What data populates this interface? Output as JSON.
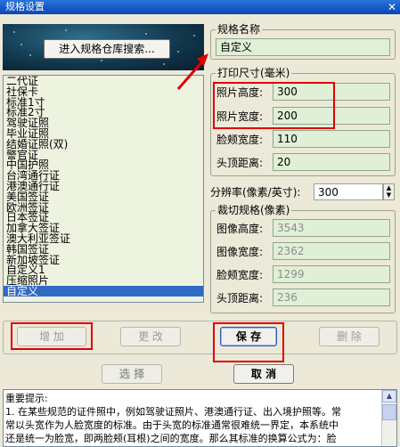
{
  "window": {
    "title": "规格设置",
    "close_glyph": "✕"
  },
  "search_button": "进入规格仓库搜索...",
  "spec_list": {
    "items": [
      "二代证",
      "社保卡",
      "标准1寸",
      "标准2寸",
      "驾驶证照",
      "毕业证照",
      "结婚证照(双)",
      "警官证",
      "中国护照",
      "台湾通行证",
      "港澳通行证",
      "美国签证",
      "欧洲签证",
      "日本签证",
      "加拿大签证",
      "澳大利亚签证",
      "韩国签证",
      "新加坡签证",
      "自定义1",
      "压缩照片",
      "自定义"
    ],
    "selected_index": 20
  },
  "spec_name": {
    "label": "规格名称",
    "value": "自定义"
  },
  "print_size": {
    "label": "打印尺寸(毫米)",
    "photo_height": {
      "label": "照片高度:",
      "value": "300"
    },
    "photo_width": {
      "label": "照片宽度:",
      "value": "200"
    },
    "face_width": {
      "label": "脸颊宽度:",
      "value": "110"
    },
    "head_distance": {
      "label": "头顶距离:",
      "value": "20"
    }
  },
  "resolution": {
    "label": "分辨率(像素/英寸):",
    "value": "300"
  },
  "crop_spec": {
    "label": "裁切规格(像素)",
    "image_height": {
      "label": "图像高度:",
      "value": "3543"
    },
    "image_width": {
      "label": "图像宽度:",
      "value": "2362"
    },
    "face_width": {
      "label": "脸颊宽度:",
      "value": "1299"
    },
    "head_distance": {
      "label": "头顶距离:",
      "value": "236"
    }
  },
  "buttons": {
    "add": "增 加",
    "modify": "更 改",
    "save": "保 存",
    "delete": "删 除",
    "select": "选   择",
    "cancel": "取 消"
  },
  "notes": {
    "heading": "重要提示:",
    "line1": "1. 在某些规范的证件照中，例如驾驶证照片、港澳通行证、出入境护照等。常",
    "line2": "常以头宽作为人脸宽度的标准。由于头宽的标准通常很难统一界定，本系统中",
    "line3": "还是统一为脸宽，即两脸颊(耳根)之间的宽度。那么其标准的换算公式为：脸"
  },
  "annotation_color": "#e00000"
}
